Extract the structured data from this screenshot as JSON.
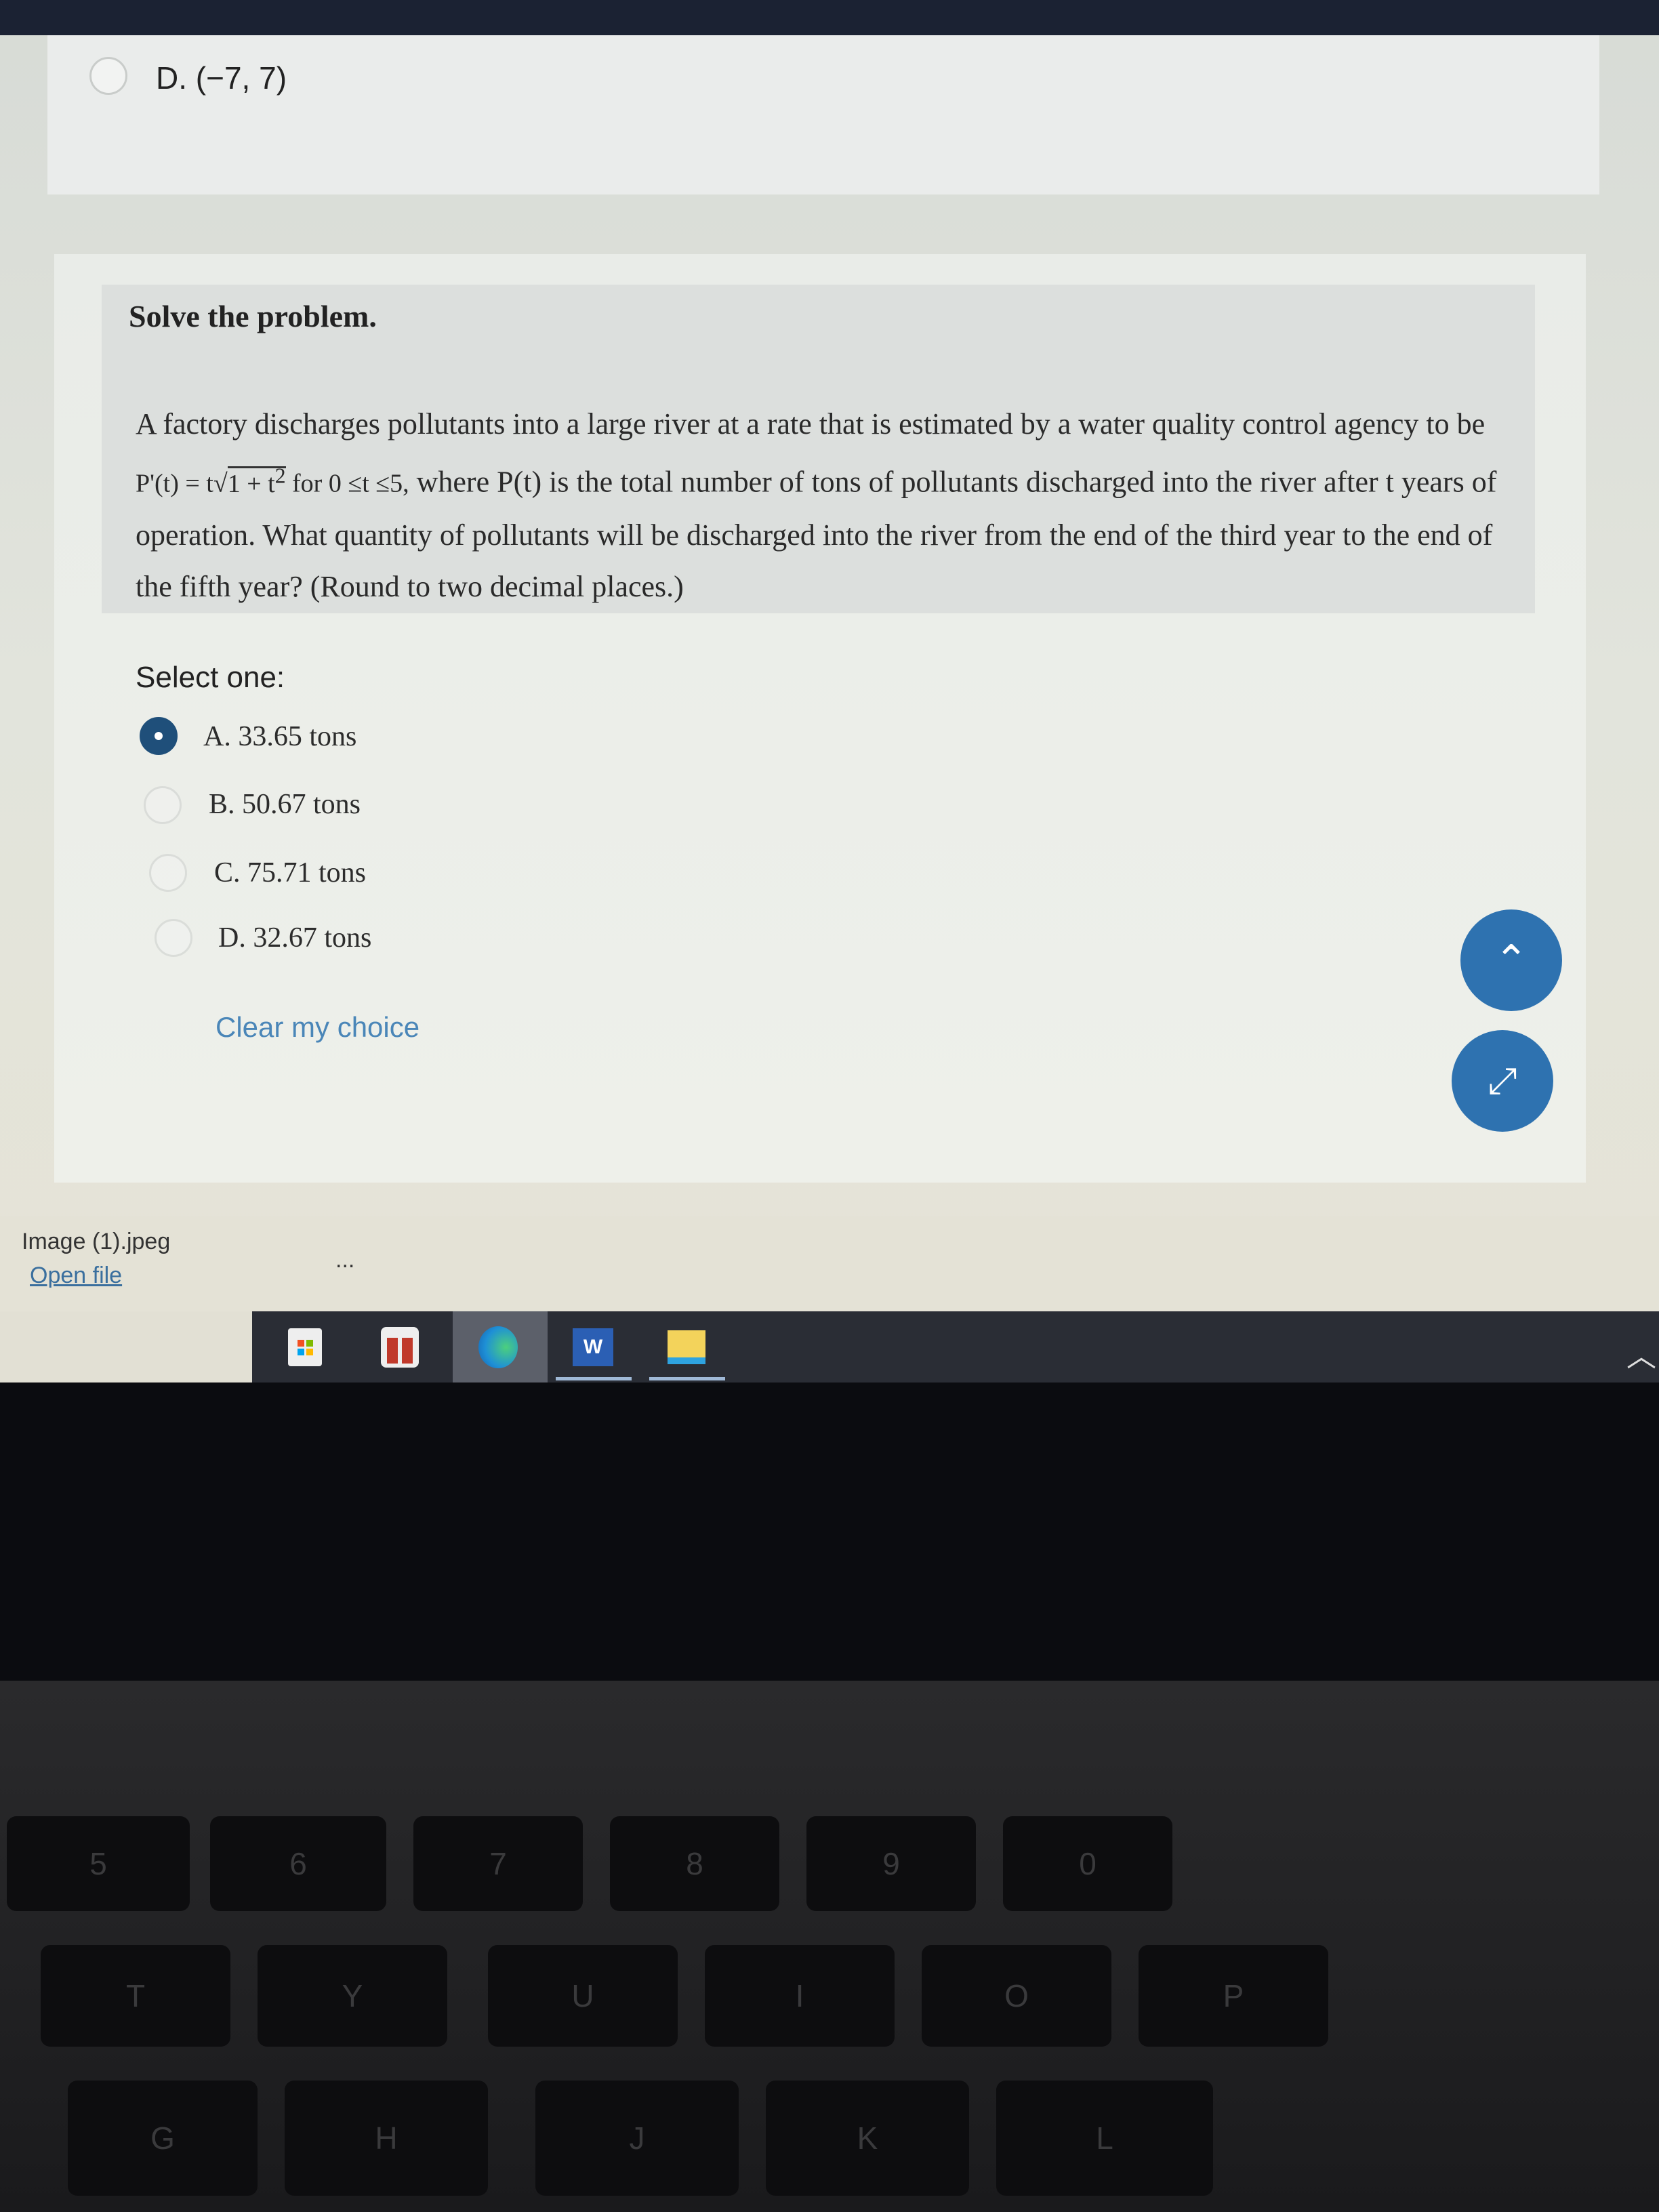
{
  "previous_question": {
    "option_d": "D. (−7, 7)"
  },
  "question": {
    "title": "Solve the problem.",
    "text_before_formula": "A factory discharges pollutants into a large river at a rate that is estimated by a water quality control agency to be ",
    "formula_lhs": "P'(t) = t",
    "formula_radicand": "1 + t",
    "formula_exp": "2",
    "formula_domain": " for 0 ≤t ≤5,",
    "text_after_formula": " where P(t) is the total number of tons of pollutants discharged into the river after t years of operation. What quantity of pollutants will be discharged into the river from the end of the third year to the end of the fifth year? (Round to two decimal places.)"
  },
  "answers": {
    "select_label": "Select one:",
    "options": [
      {
        "label": "A. 33.65 tons",
        "selected": true
      },
      {
        "label": "B. 50.67 tons",
        "selected": false
      },
      {
        "label": "C. 75.71 tons",
        "selected": false
      },
      {
        "label": "D. 32.67 tons",
        "selected": false
      }
    ],
    "clear_label": "Clear my choice"
  },
  "fab": {
    "scroll_up": "chevron-up",
    "expand": "expand-arrows"
  },
  "download": {
    "file_name": "Image (1).jpeg",
    "open_label": "Open file",
    "more": "..."
  },
  "taskbar": {
    "icons": [
      "microsoft-store",
      "gift",
      "edge",
      "word",
      "file-explorer"
    ]
  },
  "keyboard": {
    "keys": [
      "5",
      "6",
      "7",
      "8",
      "9",
      "0",
      "T",
      "Y",
      "U",
      "I",
      "O",
      "P",
      "G",
      "H",
      "J",
      "K",
      "L"
    ]
  },
  "colors": {
    "accent": "#2e72b0",
    "link": "#4a86b8",
    "selected_radio": "#1f4f7a"
  }
}
